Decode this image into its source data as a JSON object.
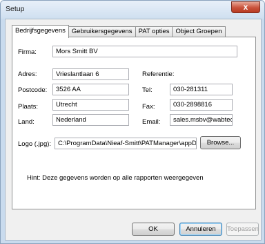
{
  "window": {
    "title": "Setup",
    "close_glyph": "x"
  },
  "tabs": [
    {
      "label": "Bedrijfsgegevens",
      "active": true
    },
    {
      "label": "Gebruikersgegevens",
      "active": false
    },
    {
      "label": "PAT opties",
      "active": false
    },
    {
      "label": "Object Groepen",
      "active": false
    }
  ],
  "form": {
    "firma": {
      "label": "Firma:",
      "value": "Mors Smitt BV"
    },
    "adres": {
      "label": "Adres:",
      "value": "Vrieslantlaan 6"
    },
    "postcode": {
      "label": "Postcode:",
      "value": "3526 AA"
    },
    "plaats": {
      "label": "Plaats:",
      "value": "Utrecht"
    },
    "land": {
      "label": "Land:",
      "value": "Nederland"
    },
    "referentie": {
      "label": "Referentie:"
    },
    "tel": {
      "label": "Tel:",
      "value": "030-281311"
    },
    "fax": {
      "label": "Fax:",
      "value": "030-2898816"
    },
    "email": {
      "label": "Email:",
      "value": "sales.msbv@wabtec.com"
    },
    "logo": {
      "label": "Logo (.jpg):",
      "value": "C:\\ProgramData\\Nieaf-Smitt\\PATManager\\appData\\"
    },
    "browse_label": "Browse..."
  },
  "hint": "Hint: Deze gegevens worden op alle rapporten weergegeven",
  "footer": {
    "ok_label": "OK",
    "cancel_label": "Annuleren",
    "apply_label": "Toepassen"
  },
  "colors": {
    "title_bar": "#cfdff0",
    "close_button": "#c9513a",
    "default_button_border": "#3c7fb1"
  }
}
